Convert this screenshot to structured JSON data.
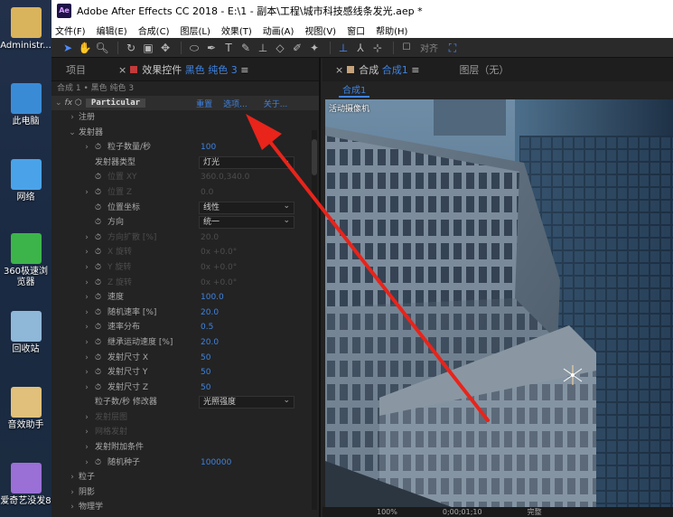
{
  "desktop": {
    "icons": [
      {
        "label": "Administr...",
        "color": "#d9b45c",
        "icon": "user-folder-icon"
      },
      {
        "label": "此电脑",
        "color": "#3a8bd6",
        "icon": "computer-icon"
      },
      {
        "label": "网络",
        "color": "#4aa3e8",
        "icon": "network-icon"
      },
      {
        "label": "360极速浏览器",
        "color": "#3cb44a",
        "icon": "browser-icon"
      },
      {
        "label": "回收站",
        "color": "#8fb7d8",
        "icon": "recycle-bin-icon"
      },
      {
        "label": "音效助手",
        "color": "#e0c07a",
        "icon": "folder-icon"
      },
      {
        "label": "爱奇艺没发8",
        "color": "#9a6fd6",
        "icon": "folder-icon"
      }
    ]
  },
  "window": {
    "title": "Adobe After Effects CC 2018 - E:\\1 - 副本\\工程\\城市科技感线条发光.aep *",
    "logo": "Ae"
  },
  "menu": [
    "文件(F)",
    "编辑(E)",
    "合成(C)",
    "图层(L)",
    "效果(T)",
    "动画(A)",
    "视图(V)",
    "窗口",
    "帮助(H)"
  ],
  "toolbar": {
    "snap_label": "对齐"
  },
  "left_panel": {
    "tab_project": "项目",
    "tab_effects_prefix": "效果控件",
    "tab_effects_layer": "黑色 纯色 3",
    "breadcrumb": "合成 1 • 黑色 纯色 3",
    "effect_name": "Particular",
    "effect_links": [
      "重置",
      "选项...",
      "关于..."
    ],
    "rows": [
      {
        "indent": 1,
        "arrow": "›",
        "label": "注册",
        "dim": false
      },
      {
        "indent": 1,
        "arrow": "⌄",
        "label": "发射器",
        "dim": false
      },
      {
        "indent": 2,
        "arrow": "›",
        "sw": true,
        "label": "粒子数量/秒",
        "value": "100",
        "dim": false
      },
      {
        "indent": 2,
        "label": "发射器类型",
        "dropdown": "灯光",
        "dim": false
      },
      {
        "indent": 2,
        "sw": true,
        "label": "位置 XY",
        "value": "360.0,340.0",
        "dim": true
      },
      {
        "indent": 2,
        "arrow": "›",
        "sw": true,
        "label": "位置 Z",
        "value": "0.0",
        "dim": true
      },
      {
        "indent": 2,
        "sw": true,
        "label": "位置坐标",
        "dropdown": "线性",
        "dim": false
      },
      {
        "indent": 2,
        "sw": true,
        "label": "方向",
        "dropdown": "统一",
        "dim": false
      },
      {
        "indent": 2,
        "arrow": "›",
        "sw": true,
        "label": "方向扩散 [%]",
        "value": "20.0",
        "dim": true
      },
      {
        "indent": 2,
        "arrow": "›",
        "sw": true,
        "label": "X 旋转",
        "value": "0x +0.0°",
        "dim": true
      },
      {
        "indent": 2,
        "arrow": "›",
        "sw": true,
        "label": "Y 旋转",
        "value": "0x +0.0°",
        "dim": true
      },
      {
        "indent": 2,
        "arrow": "›",
        "sw": true,
        "label": "Z 旋转",
        "value": "0x +0.0°",
        "dim": true
      },
      {
        "indent": 2,
        "arrow": "›",
        "sw": true,
        "label": "速度",
        "value": "100.0",
        "dim": false
      },
      {
        "indent": 2,
        "arrow": "›",
        "sw": true,
        "label": "随机速率 [%]",
        "value": "20.0",
        "dim": false
      },
      {
        "indent": 2,
        "arrow": "›",
        "sw": true,
        "label": "速率分布",
        "value": "0.5",
        "dim": false
      },
      {
        "indent": 2,
        "arrow": "›",
        "sw": true,
        "label": "继承运动速度 [%]",
        "value": "20.0",
        "dim": false
      },
      {
        "indent": 2,
        "arrow": "›",
        "sw": true,
        "label": "发射尺寸 X",
        "value": "50",
        "dim": false
      },
      {
        "indent": 2,
        "arrow": "›",
        "sw": true,
        "label": "发射尺寸 Y",
        "value": "50",
        "dim": false
      },
      {
        "indent": 2,
        "arrow": "›",
        "sw": true,
        "label": "发射尺寸 Z",
        "value": "50",
        "dim": false
      },
      {
        "indent": 2,
        "label": "粒子数/秒 修改器",
        "dropdown": "光照强度",
        "dim": false
      },
      {
        "indent": 2,
        "arrow": "›",
        "label": "发射层图",
        "dim": true
      },
      {
        "indent": 2,
        "arrow": "›",
        "label": "网格发射",
        "dim": true
      },
      {
        "indent": 2,
        "arrow": "›",
        "label": "发射附加条件",
        "dim": false
      },
      {
        "indent": 2,
        "arrow": "›",
        "sw": true,
        "label": "随机种子",
        "value": "100000",
        "dim": false
      },
      {
        "indent": 1,
        "arrow": "›",
        "label": "粒子",
        "dim": false
      },
      {
        "indent": 1,
        "arrow": "›",
        "label": "阴影",
        "dim": false
      },
      {
        "indent": 1,
        "arrow": "›",
        "label": "物理学",
        "dim": false
      }
    ]
  },
  "right_panel": {
    "tab_comp_prefix": "合成",
    "tab_comp_name": "合成1",
    "tab_layer": "图层（无）",
    "subtab": "合成1",
    "camera_label": "活动摄像机",
    "zoom": "100%",
    "timecode": "0;00;01;10",
    "quality": "完整"
  },
  "colors": {
    "accent": "#3f83e0",
    "arrow": "#e8241b"
  }
}
